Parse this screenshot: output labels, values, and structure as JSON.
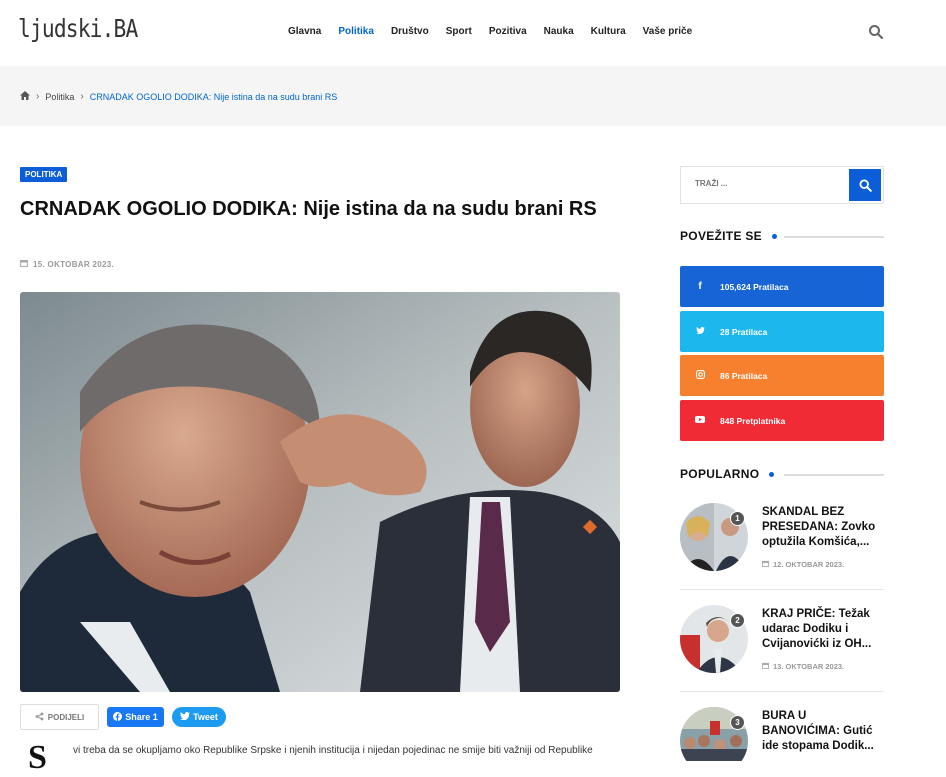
{
  "header": {
    "logo": "ljudski.BA",
    "nav": [
      "Glavna",
      "Politika",
      "Društvo",
      "Sport",
      "Pozitiva",
      "Nauka",
      "Kultura",
      "Vaše priče"
    ],
    "nav_active": "Politika"
  },
  "breadcrumb": {
    "items": [
      "Politika"
    ],
    "current": "CRNADAK OGOLIO DODIKA: Nije istina da na sudu brani RS"
  },
  "article": {
    "category": "POLITIKA",
    "title": "CRNADAK OGOLIO DODIKA: Nije istina da na sudu brani RS",
    "date": "15. OKTOBAR 2023.",
    "share_label": "PODIJELI",
    "fb_label": "Share 1",
    "tw_label": "Tweet",
    "dropcap": "S",
    "body_first_line": "vi treba da se okupljamo oko Republike Srpske i njenih institucija i nijedan pojedinac ne smije biti važniji od Republike"
  },
  "sidebar": {
    "search_placeholder": "TRAŽI ...",
    "connect_heading": "POVEŽITE SE",
    "social": [
      {
        "icon": "facebook-icon",
        "glyph": "f",
        "label": "105,624 Pratilaca",
        "color": "#1764d6"
      },
      {
        "icon": "twitter-icon",
        "glyph": "t",
        "label": "28 Pratilaca",
        "color": "#1cb7ec"
      },
      {
        "icon": "instagram-icon",
        "glyph": "◎",
        "label": "86 Pratilaca",
        "color": "#f6802d"
      },
      {
        "icon": "youtube-icon",
        "glyph": "▶",
        "label": "848 Pretplatnika",
        "color": "#f02b35"
      }
    ],
    "popular_heading": "POPULARNO",
    "popular": [
      {
        "num": "1",
        "title": "SKANDAL BEZ PRESEDANA: Zovko optužila Komšića,...",
        "date": "12. OKTOBAR 2023."
      },
      {
        "num": "2",
        "title": "KRAJ PRIČE: Težak udarac Dodiku i Cvijanovićki iz OH...",
        "date": "13. OKTOBAR 2023."
      },
      {
        "num": "3",
        "title": "BURA U BANOVIĆIMA: Gutić ide stopama Dodik...",
        "date": ""
      }
    ]
  }
}
